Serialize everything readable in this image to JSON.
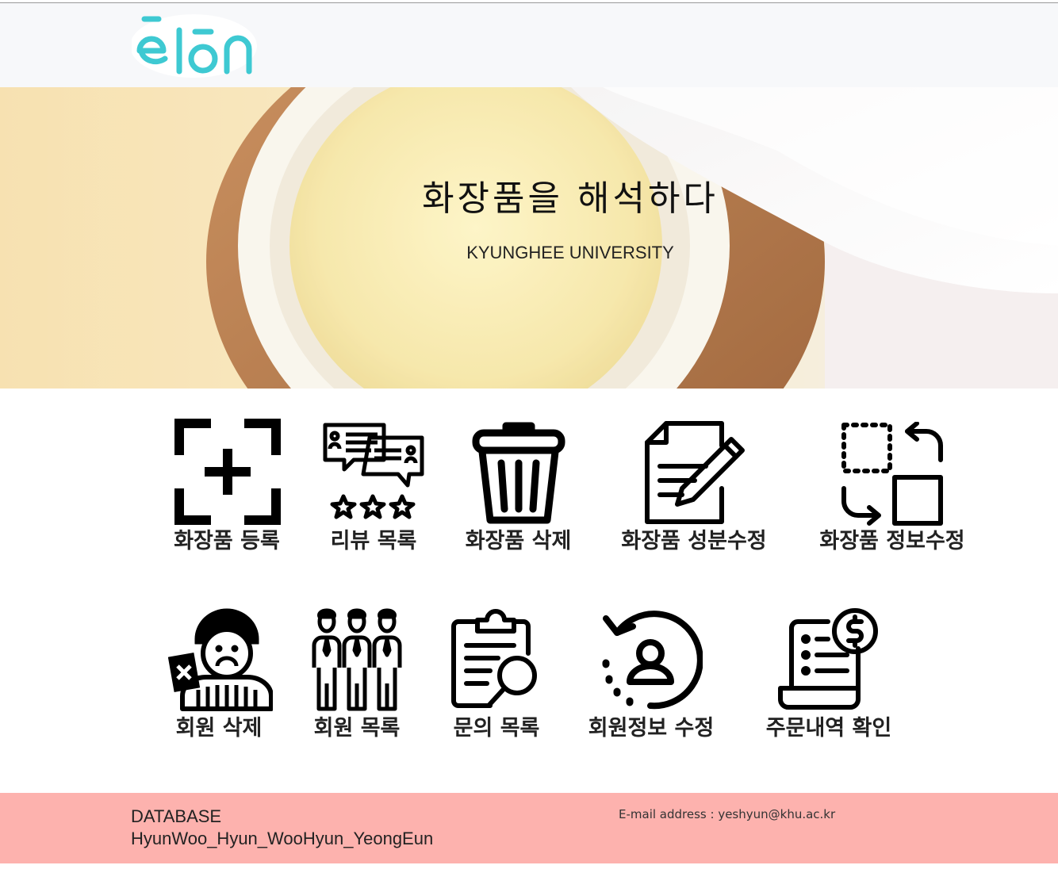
{
  "header": {
    "logo_text": "ēlōn",
    "brand_color": "#3ec9d2"
  },
  "hero": {
    "title": "화장품을 해석하다",
    "subtitle": "KYUNGHEE UNIVERSITY"
  },
  "menu": {
    "row1": [
      {
        "label": "화장품 등록",
        "icon": "add-frame-icon"
      },
      {
        "label": "리뷰 목록",
        "icon": "review-chat-stars-icon"
      },
      {
        "label": "화장품 삭제",
        "icon": "trash-can-icon"
      },
      {
        "label": "화장품 성분수정",
        "icon": "document-edit-icon"
      },
      {
        "label": "화장품 정보수정",
        "icon": "swap-squares-icon"
      }
    ],
    "row2": [
      {
        "label": "회원 삭제",
        "icon": "user-reject-icon"
      },
      {
        "label": "회원 목록",
        "icon": "user-group-icon"
      },
      {
        "label": "문의 목록",
        "icon": "clipboard-search-icon"
      },
      {
        "label": "회원정보 수정",
        "icon": "user-refresh-icon"
      },
      {
        "label": "주문내역 확인",
        "icon": "order-receipt-icon"
      }
    ]
  },
  "footer": {
    "title": "DATABASE",
    "team": "HyunWoo_Hyun_WooHyun_YeongEun",
    "email": "E-mail address : yeshyun@khu.ac.kr",
    "background": "#fdb2ae"
  }
}
